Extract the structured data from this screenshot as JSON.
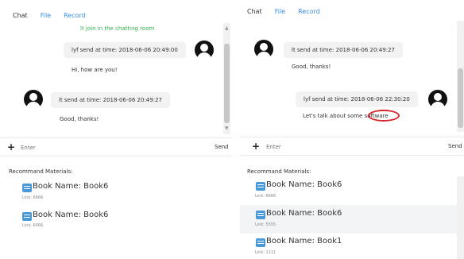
{
  "left": {
    "tabs": [
      {
        "label": "Chat"
      },
      {
        "label": "File"
      },
      {
        "label": "Record"
      }
    ],
    "system_message": "lt join in the chatting room",
    "messages": [
      {
        "header": "lyf send at time: 2018-06-06 20:49:00",
        "text": "Hi, how are you!"
      },
      {
        "header": "lt send at time: 2018-06-06 20:49:27",
        "text": "Good, thanks!"
      }
    ],
    "input_placeholder": "Enter",
    "send_label": "Send",
    "materials_title": "Recommand Materials:",
    "materials": [
      {
        "name": "Book Name: Book6",
        "link": "Link: 6666"
      },
      {
        "name": "Book Name: Book6",
        "link": "Link: 6666"
      }
    ]
  },
  "right": {
    "tabs": [
      {
        "label": "Chat"
      },
      {
        "label": "File"
      },
      {
        "label": "Record"
      }
    ],
    "messages": [
      {
        "header": "lt send at time: 2018-06-06 20:49:27",
        "text": "Good, thanks!"
      },
      {
        "header": "lyf send at time: 2018-06-06 22:30:20",
        "text": "Let's talk about some software"
      }
    ],
    "input_placeholder": "Enter",
    "send_label": "Send",
    "materials_title": "Recommand Materials:",
    "materials": [
      {
        "name": "Book Name: Book6",
        "link": "Link: 6666"
      },
      {
        "name": "Book Name: Book6",
        "link": "Link: 5555"
      },
      {
        "name": "Book Name: Book1",
        "link": "Link: 1111"
      }
    ]
  },
  "colors": {
    "accent": "#3a8ee6",
    "system_text": "#2db34a",
    "annotation": "#d8262c"
  }
}
